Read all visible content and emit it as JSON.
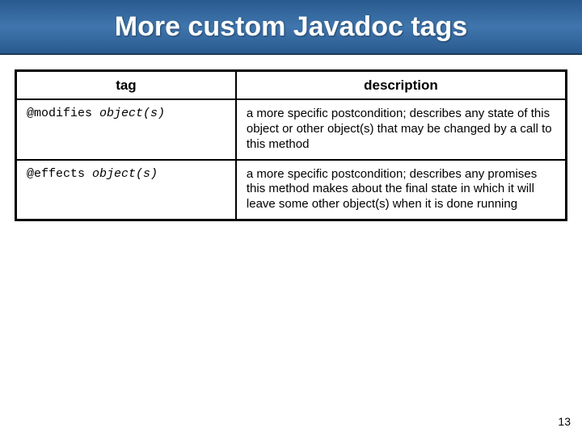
{
  "title": "More custom Javadoc tags",
  "table": {
    "headers": {
      "tag": "tag",
      "description": "description"
    },
    "rows": [
      {
        "tag_name": "@modifies",
        "tag_param": "object(s)",
        "description": "a more specific postcondition; describes any state of this object or other object(s) that may be changed by a call to this method"
      },
      {
        "tag_name": "@effects",
        "tag_param": "object(s)",
        "description": "a more specific postcondition; describes any promises this method makes about the final state in which it will leave some other object(s) when it is done running"
      }
    ]
  },
  "page_number": "13"
}
